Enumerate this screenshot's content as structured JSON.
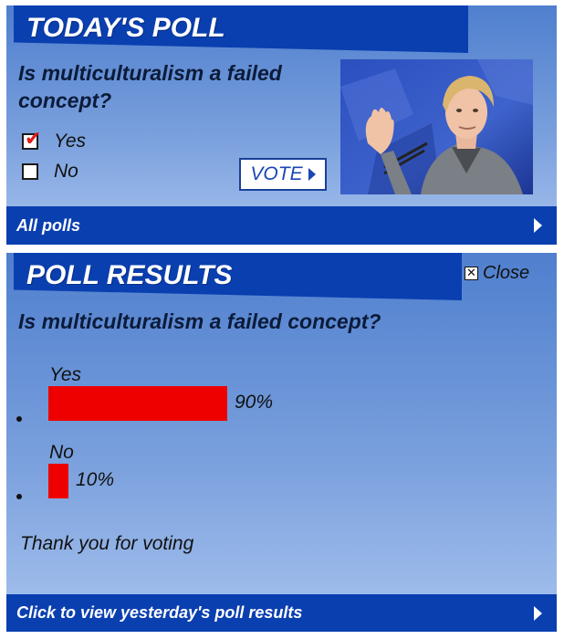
{
  "today_poll": {
    "title": "TODAY'S POLL",
    "question": "Is multiculturalism a failed concept?",
    "options": [
      {
        "label": "Yes",
        "checked": true
      },
      {
        "label": "No",
        "checked": false
      }
    ],
    "vote_label": "VOTE",
    "footer_label": "All polls"
  },
  "poll_results": {
    "title": "POLL RESULTS",
    "close_label": "Close",
    "question": "Is multiculturalism a failed concept?",
    "results": [
      {
        "label": "Yes",
        "percent_text": "90%",
        "percent": 90
      },
      {
        "label": "No",
        "percent_text": "10%",
        "percent": 10
      }
    ],
    "thanks": "Thank you for voting",
    "footer_label": "Click to view yesterday's poll results"
  },
  "colors": {
    "header_blue": "#0a3fb0",
    "result_bar": "#ee0000",
    "check_red": "#e01a1a"
  },
  "icons": {
    "check": "checkmark-icon",
    "arrow": "triangle-right-icon",
    "close": "close-x-icon"
  }
}
